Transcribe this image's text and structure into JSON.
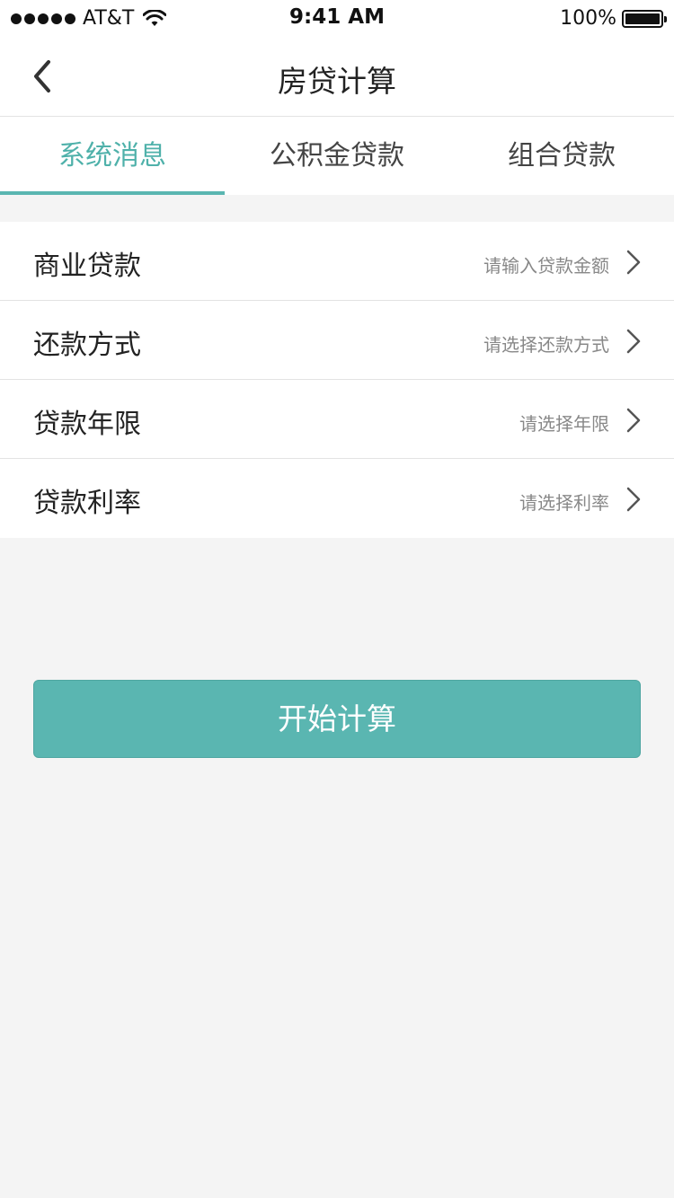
{
  "status_bar": {
    "carrier": "AT&T",
    "time": "9:41 AM",
    "battery": "100%"
  },
  "nav": {
    "title": "房贷计算"
  },
  "tabs": [
    {
      "label": "系统消息",
      "active": true
    },
    {
      "label": "公积金贷款",
      "active": false
    },
    {
      "label": "组合贷款",
      "active": false
    }
  ],
  "form": {
    "rows": [
      {
        "label": "商业贷款",
        "placeholder": "请输入贷款金额"
      },
      {
        "label": "还款方式",
        "placeholder": "请选择还款方式"
      },
      {
        "label": "贷款年限",
        "placeholder": "请选择年限"
      },
      {
        "label": "贷款利率",
        "placeholder": "请选择利率"
      }
    ]
  },
  "actions": {
    "start_label": "开始计算"
  },
  "colors": {
    "accent": "#5ab6b1",
    "accent_text": "#4fb1aa",
    "page_bg": "#f4f4f4"
  },
  "icons": {
    "back": "chevron-left-icon",
    "row_arrow": "chevron-right-icon",
    "wifi": "wifi-icon",
    "battery": "battery-icon"
  }
}
